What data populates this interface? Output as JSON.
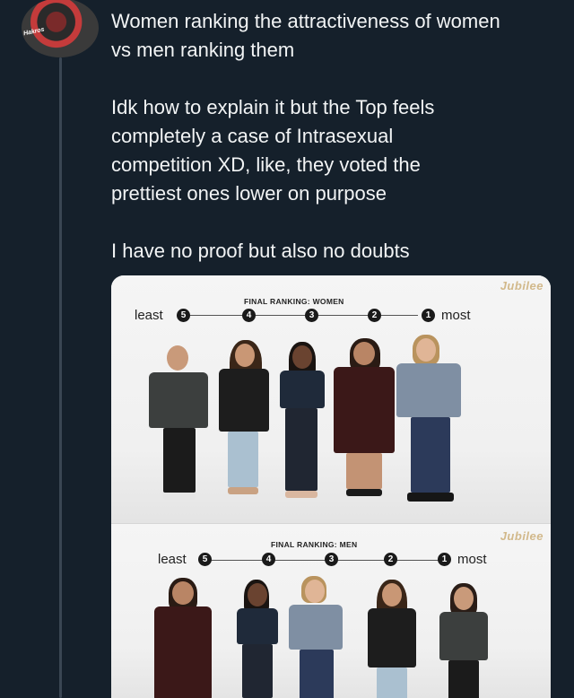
{
  "tweet": {
    "line1": "Women ranking the attractiveness of women",
    "line2": "vs men ranking them",
    "line3": "Idk how to explain it but the Top feels",
    "line4": "completely a case of Intrasexual",
    "line5": "competition XD, like, they voted the",
    "line6": "prettiest ones lower on purpose",
    "line7": "I have no proof but also no doubts"
  },
  "avatar": {
    "badge_text": "Hakros"
  },
  "media": {
    "top": {
      "watermark": "Jubilee",
      "title": "FINAL RANKING: WOMEN",
      "least_label": "least",
      "most_label": "most",
      "numbers": [
        "5",
        "4",
        "3",
        "2",
        "1"
      ]
    },
    "bottom": {
      "watermark": "Jubilee",
      "title": "FINAL RANKING: MEN",
      "least_label": "least",
      "most_label": "most",
      "numbers": [
        "5",
        "4",
        "3",
        "2",
        "1"
      ]
    }
  }
}
